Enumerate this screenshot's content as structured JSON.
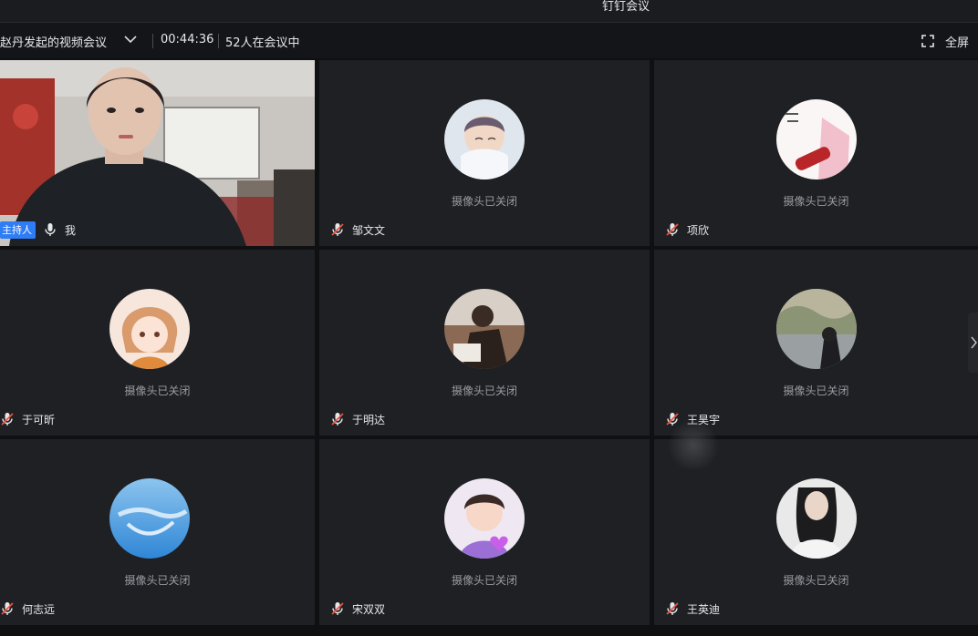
{
  "app": {
    "title": "钉钉会议"
  },
  "toolbar": {
    "meeting_title": "赵丹发起的视频会议",
    "elapsed": "00:44:36",
    "participants": "52人在会议中",
    "fullscreen_label": "全屏"
  },
  "camera_off_text": "摄像头已关闭",
  "host_badge": "主持人",
  "tiles": [
    {
      "name": "我",
      "video": true,
      "muted": false
    },
    {
      "name": "邹文文",
      "muted": true
    },
    {
      "name": "项欣",
      "muted": true
    },
    {
      "name": "于可昕",
      "muted": true
    },
    {
      "name": "于明达",
      "muted": true
    },
    {
      "name": "王昊宇",
      "muted": true
    },
    {
      "name": "何志远",
      "muted": true
    },
    {
      "name": "宋双双",
      "muted": true
    },
    {
      "name": "王英迪",
      "muted": true
    }
  ],
  "colors": {
    "accent": "#2e7cf6",
    "muted_icon": "#e8533f",
    "tile_bg": "#1f2024"
  }
}
